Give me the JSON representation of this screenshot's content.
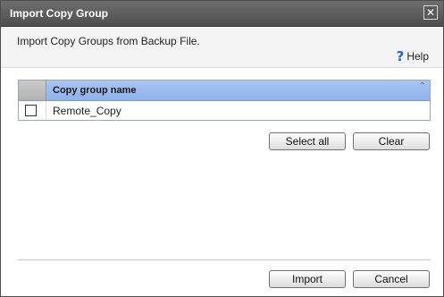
{
  "window": {
    "title": "Import Copy Group",
    "close_glyph": "✕"
  },
  "header": {
    "description": "Import Copy Groups from Backup File.",
    "help_label": "Help",
    "help_glyph": "?"
  },
  "table": {
    "columns": [
      "",
      "Copy group name"
    ],
    "sort_glyph": "⌃",
    "rows": [
      {
        "checked": false,
        "name": "Remote_Copy"
      }
    ]
  },
  "buttons": {
    "select_all": "Select all",
    "clear": "Clear",
    "import": "Import",
    "cancel": "Cancel"
  },
  "colors": {
    "titlebar": "#5e5e5e",
    "header_bg": "#f3f3f3",
    "table_header": "#9dbcf0",
    "help_icon": "#2a64c8"
  }
}
